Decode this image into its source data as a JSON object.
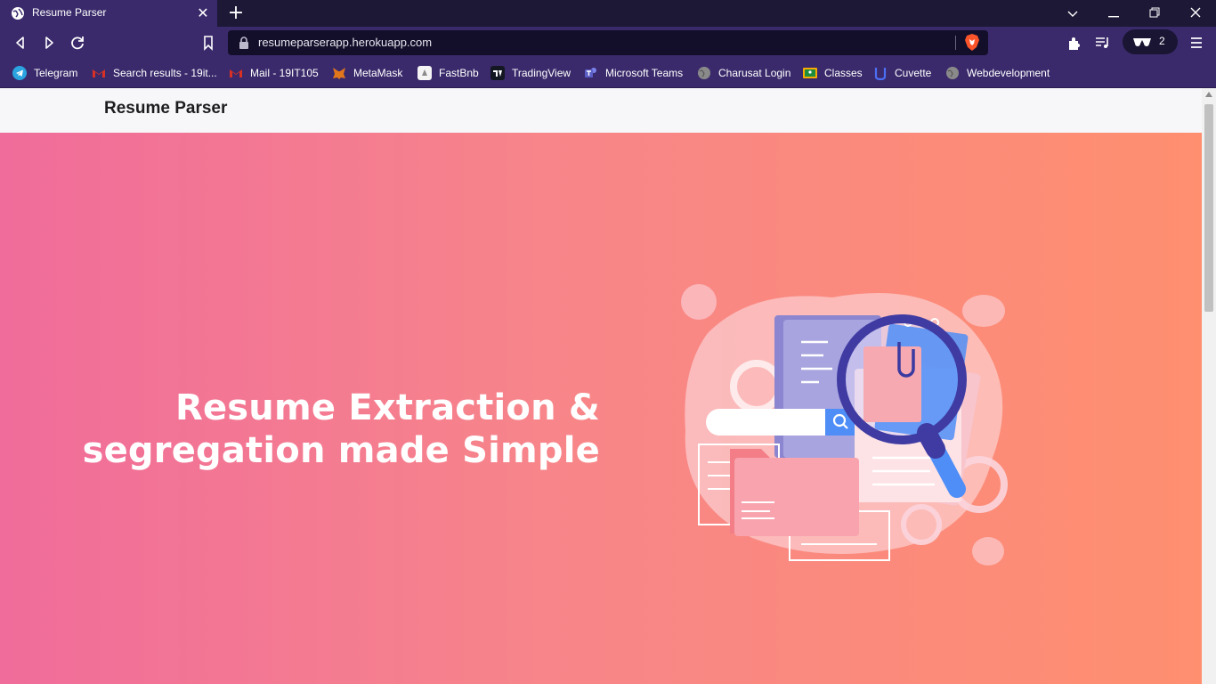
{
  "browser": {
    "tab": {
      "title": "Resume Parser",
      "close_label": "✕"
    },
    "new_tab_label": "+",
    "url": "resumeparserapp.herokuapp.com",
    "vpn_count": "2",
    "bookmarks": [
      {
        "label": "Telegram",
        "icon": "telegram-icon",
        "color": "#2aa3e0"
      },
      {
        "label": "Search results - 19it...",
        "icon": "gmail-icon",
        "color": "#d93025"
      },
      {
        "label": "Mail - 19IT105",
        "icon": "gmail-icon",
        "color": "#d93025"
      },
      {
        "label": "MetaMask",
        "icon": "metamask-icon",
        "color": "#e2761b"
      },
      {
        "label": "FastBnb",
        "icon": "fastbnb-icon",
        "color": "#ffffff"
      },
      {
        "label": "TradingView",
        "icon": "tradingview-icon",
        "color": "#131722"
      },
      {
        "label": "Microsoft Teams",
        "icon": "teams-icon",
        "color": "#5b5fc7"
      },
      {
        "label": "Charusat Login",
        "icon": "globe-icon",
        "color": "#8a8a8a"
      },
      {
        "label": "Classes",
        "icon": "classroom-icon",
        "color": "#f9ab00"
      },
      {
        "label": "Cuvette",
        "icon": "cuvette-icon",
        "color": "#4c6ef5"
      },
      {
        "label": "Webdevelopment",
        "icon": "globe-icon",
        "color": "#8a8a8a"
      }
    ]
  },
  "page": {
    "brand": "Resume Parser",
    "headline_line1": "Resume Extraction &",
    "headline_line2": "segregation made Simple"
  },
  "colors": {
    "hero_gradient_start": "#f06c9b",
    "hero_gradient_end": "#ff8f6f",
    "browser_chrome": "#3a2a6b"
  }
}
